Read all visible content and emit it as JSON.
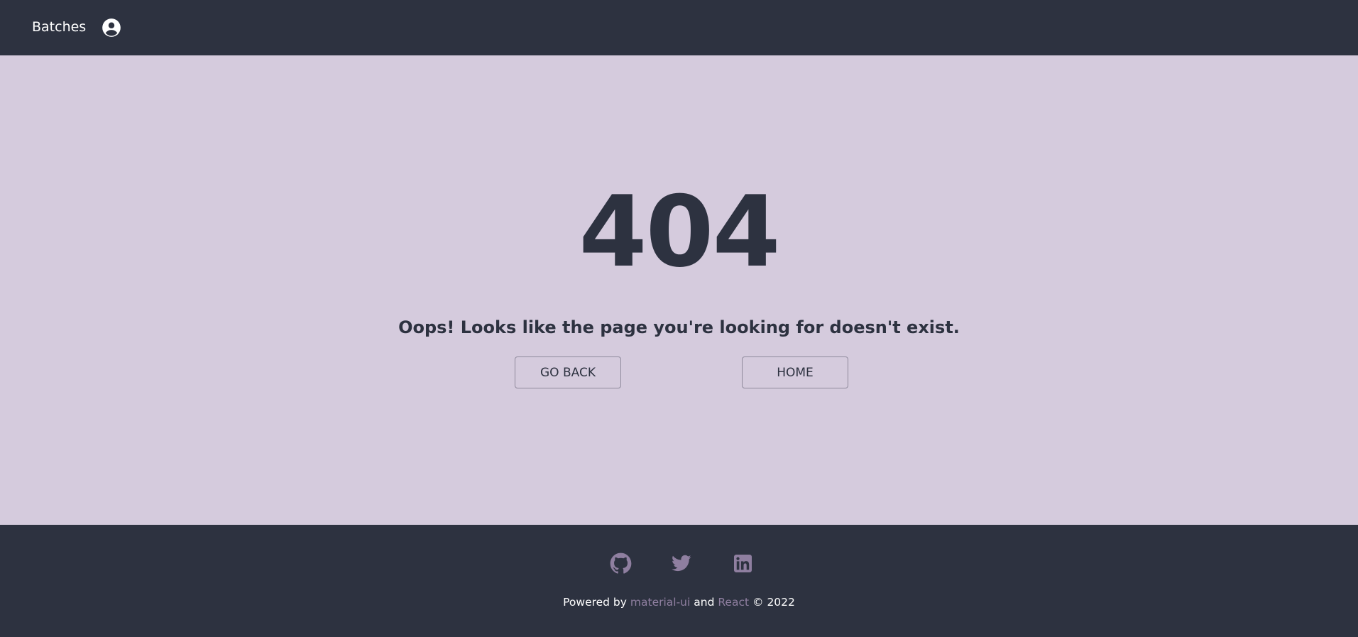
{
  "header": {
    "brand": "Batches",
    "account_icon": "account-circle-icon"
  },
  "error": {
    "code": "404",
    "message": "Oops! Looks like the page you're looking for doesn't exist.",
    "back_label": "GO BACK",
    "home_label": "HOME"
  },
  "footer": {
    "social": [
      "github-icon",
      "twitter-icon",
      "linkedin-icon"
    ],
    "powered_prefix": "Powered by",
    "link1": "material-ui",
    "and_text": "and",
    "link2": "React",
    "suffix": "© 2022"
  },
  "colors": {
    "header_bg": "#2d3240",
    "page_bg": "#d5cbdd",
    "text_dark": "#2d3240",
    "link_muted": "#8f7fa0",
    "icon_muted": "#8f7fa0"
  }
}
